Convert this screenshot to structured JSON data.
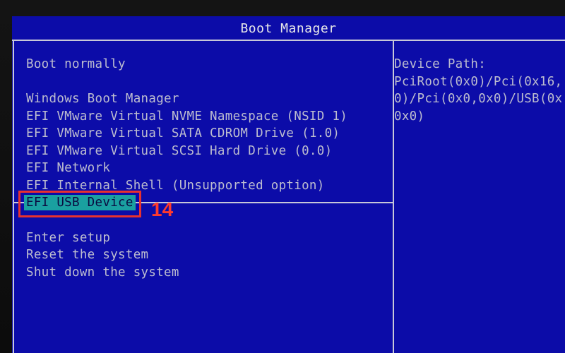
{
  "title": "Boot Manager",
  "menu": {
    "boot_normally": "Boot normally",
    "boot_options": [
      "Windows Boot Manager",
      "EFI VMware Virtual NVME Namespace (NSID 1)",
      "EFI VMware Virtual SATA CDROM Drive (1.0)",
      "EFI VMware Virtual SCSI Hard Drive (0.0)",
      "EFI Network",
      "EFI Internal Shell (Unsupported option)",
      "EFI USB Device"
    ],
    "selected_index": 6,
    "system_options": [
      "Enter setup",
      "Reset the system",
      "Shut down the system"
    ]
  },
  "device_path": {
    "label": "Device Path:",
    "lines": [
      "PciRoot(0x0)/Pci(0x16,",
      "0)/Pci(0x0,0x0)/USB(0x",
      "0x0)"
    ]
  },
  "annotation": {
    "step_number": "14",
    "color": "#e8322e"
  },
  "colors": {
    "background": "#0c0ca8",
    "text": "#bdbdcf",
    "selected_bg": "#1aa0a0",
    "frame": "#c8c8d8"
  }
}
